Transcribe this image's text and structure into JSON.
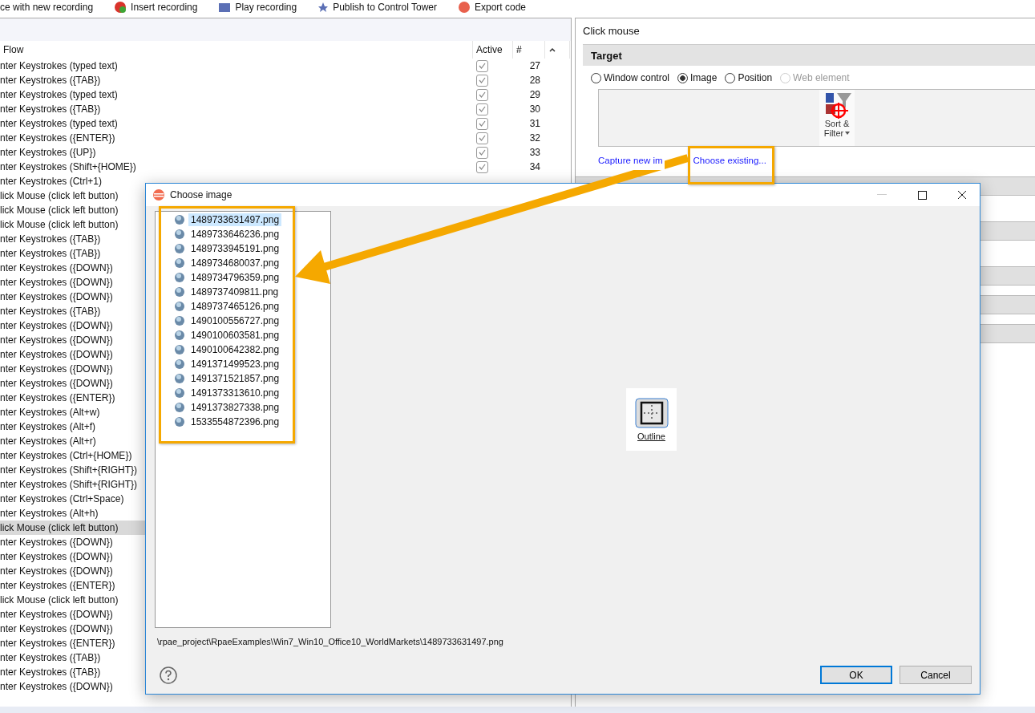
{
  "toolbar": [
    {
      "label": "ce with new recording"
    },
    {
      "label": "Insert recording"
    },
    {
      "label": "Play recording"
    },
    {
      "label": "Publish to Control Tower"
    },
    {
      "label": "Export code"
    }
  ],
  "flow_table": {
    "columns": [
      "Flow",
      "Active",
      "#"
    ],
    "rows": [
      {
        "flow": "nter Keystrokes (typed text)",
        "active": true,
        "number": "27",
        "selected": false
      },
      {
        "flow": "nter Keystrokes ({TAB})",
        "active": true,
        "number": "28",
        "selected": false
      },
      {
        "flow": "nter Keystrokes (typed text)",
        "active": true,
        "number": "29",
        "selected": false
      },
      {
        "flow": "nter Keystrokes ({TAB})",
        "active": true,
        "number": "30",
        "selected": false
      },
      {
        "flow": "nter Keystrokes (typed text)",
        "active": true,
        "number": "31",
        "selected": false
      },
      {
        "flow": "nter Keystrokes ({ENTER})",
        "active": true,
        "number": "32",
        "selected": false
      },
      {
        "flow": "nter Keystrokes ({UP})",
        "active": true,
        "number": "33",
        "selected": false
      },
      {
        "flow": "nter Keystrokes (Shift+{HOME})",
        "active": true,
        "number": "34",
        "selected": false
      },
      {
        "flow": "nter Keystrokes (Ctrl+1)",
        "selected": false
      },
      {
        "flow": "lick Mouse (click left button)",
        "selected": false
      },
      {
        "flow": "lick Mouse (click left button)",
        "selected": false
      },
      {
        "flow": "lick Mouse (click left button)",
        "selected": false
      },
      {
        "flow": "nter Keystrokes ({TAB})",
        "selected": false
      },
      {
        "flow": "nter Keystrokes ({TAB})",
        "selected": false
      },
      {
        "flow": "nter Keystrokes ({DOWN})",
        "selected": false
      },
      {
        "flow": "nter Keystrokes ({DOWN})",
        "selected": false
      },
      {
        "flow": "nter Keystrokes ({DOWN})",
        "selected": false
      },
      {
        "flow": "nter Keystrokes ({TAB})",
        "selected": false
      },
      {
        "flow": "nter Keystrokes ({DOWN})",
        "selected": false
      },
      {
        "flow": "nter Keystrokes ({DOWN})",
        "selected": false
      },
      {
        "flow": "nter Keystrokes ({DOWN})",
        "selected": false
      },
      {
        "flow": "nter Keystrokes ({DOWN})",
        "selected": false
      },
      {
        "flow": "nter Keystrokes ({DOWN})",
        "selected": false
      },
      {
        "flow": "nter Keystrokes ({ENTER})",
        "selected": false
      },
      {
        "flow": "nter Keystrokes (Alt+w)",
        "selected": false
      },
      {
        "flow": "nter Keystrokes (Alt+f)",
        "selected": false
      },
      {
        "flow": "nter Keystrokes (Alt+r)",
        "selected": false
      },
      {
        "flow": "nter Keystrokes (Ctrl+{HOME})",
        "selected": false
      },
      {
        "flow": "nter Keystrokes (Shift+{RIGHT})",
        "selected": false
      },
      {
        "flow": "nter Keystrokes (Shift+{RIGHT})",
        "selected": false
      },
      {
        "flow": "nter Keystrokes (Ctrl+Space)",
        "selected": false
      },
      {
        "flow": "nter Keystrokes (Alt+h)",
        "selected": false
      },
      {
        "flow": "lick Mouse (click left button)",
        "selected": true
      },
      {
        "flow": "nter Keystrokes ({DOWN})",
        "selected": false
      },
      {
        "flow": "nter Keystrokes ({DOWN})",
        "selected": false
      },
      {
        "flow": "nter Keystrokes ({DOWN})",
        "selected": false
      },
      {
        "flow": "nter Keystrokes ({ENTER})",
        "selected": false
      },
      {
        "flow": "lick Mouse (click left button)",
        "selected": false
      },
      {
        "flow": "nter Keystrokes ({DOWN})",
        "selected": false
      },
      {
        "flow": "nter Keystrokes ({DOWN})",
        "selected": false
      },
      {
        "flow": "nter Keystrokes ({ENTER})",
        "selected": false
      },
      {
        "flow": "nter Keystrokes ({TAB})",
        "selected": false
      },
      {
        "flow": "nter Keystrokes ({TAB})",
        "selected": false
      },
      {
        "flow": "nter Keystrokes ({DOWN})",
        "selected": false
      }
    ]
  },
  "properties": {
    "title": "Click mouse",
    "section": "Target",
    "target_options": [
      {
        "label": "Window control",
        "selected": false,
        "disabled": false
      },
      {
        "label": "Image",
        "selected": true,
        "disabled": false
      },
      {
        "label": "Position",
        "selected": false,
        "disabled": false
      },
      {
        "label": "Web element",
        "selected": false,
        "disabled": true
      }
    ],
    "captured_image": {
      "line_1": "Sort &",
      "line_2": "Filter"
    },
    "links": [
      "Capture new im",
      "Choose existing..."
    ]
  },
  "dialog": {
    "title": "Choose image",
    "files": [
      {
        "name": "1489733631497.png",
        "selected": true
      },
      {
        "name": "1489733646236.png",
        "selected": false
      },
      {
        "name": "1489733945191.png",
        "selected": false
      },
      {
        "name": "1489734680037.png",
        "selected": false
      },
      {
        "name": "1489734796359.png",
        "selected": false
      },
      {
        "name": "1489737409811.png",
        "selected": false
      },
      {
        "name": "1489737465126.png",
        "selected": false
      },
      {
        "name": "1490100556727.png",
        "selected": false
      },
      {
        "name": "1490100603581.png",
        "selected": false
      },
      {
        "name": "1490100642382.png",
        "selected": false
      },
      {
        "name": "1491371499523.png",
        "selected": false
      },
      {
        "name": "1491371521857.png",
        "selected": false
      },
      {
        "name": "1491373313610.png",
        "selected": false
      },
      {
        "name": "1491373827338.png",
        "selected": false
      },
      {
        "name": "1533554872396.png",
        "selected": false
      }
    ],
    "preview_label": "Outline",
    "path": "\\rpae_project\\RpaeExamples\\Win7_Win10_Office10_WorldMarkets\\1489733631497.png",
    "buttons": [
      {
        "label": "OK",
        "default": true
      },
      {
        "label": "Cancel",
        "default": false
      }
    ]
  }
}
